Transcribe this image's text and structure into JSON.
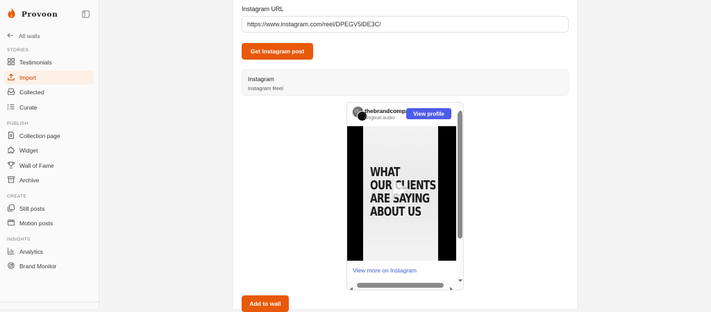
{
  "sidebar": {
    "brand": "Provoon",
    "back_label": "All walls",
    "sections": {
      "stories": "STORIES",
      "publish": "PUBLISH",
      "create": "CREATE",
      "insights": "INSIGHTS"
    },
    "items": [
      {
        "label": "Testimonials",
        "icon": "grid-icon"
      },
      {
        "label": "Import",
        "icon": "upload-icon",
        "active": true
      },
      {
        "label": "Collected",
        "icon": "inbox-icon"
      },
      {
        "label": "Curate",
        "icon": "list-icon"
      },
      {
        "label": "Collection page",
        "icon": "document-icon"
      },
      {
        "label": "Widget",
        "icon": "puzzle-icon"
      },
      {
        "label": "Wall of Fame",
        "icon": "trophy-icon"
      },
      {
        "label": "Archive",
        "icon": "archive-icon"
      },
      {
        "label": "Still posts",
        "icon": "images-icon"
      },
      {
        "label": "Motion posts",
        "icon": "film-icon"
      },
      {
        "label": "Analytics",
        "icon": "bar-chart-icon"
      },
      {
        "label": "Brand Monitor",
        "icon": "radar-icon"
      }
    ]
  },
  "form": {
    "url_label": "Instagram URL",
    "url_value": "https://www.instagram.com/reel/DPEGV5lDE3C/",
    "get_button": "Get Instagram post",
    "add_button": "Add to wall"
  },
  "preview": {
    "title": "Instagram",
    "subtitle": "Instagram Reel"
  },
  "embed": {
    "username": "thebrandcompany",
    "sub": "Original audio",
    "view_profile": "View profile",
    "video_text": [
      "WHAT",
      "OUR CLIENTS",
      "ARE SAYING",
      "ABOUT US"
    ],
    "view_more": "View more on Instagram"
  },
  "colors": {
    "accent": "#e8590c",
    "active_bg": "#fdf0e6",
    "active_text": "#c2410c",
    "instagram_blue": "#4f5bea",
    "link_blue": "#3b5bd1"
  }
}
